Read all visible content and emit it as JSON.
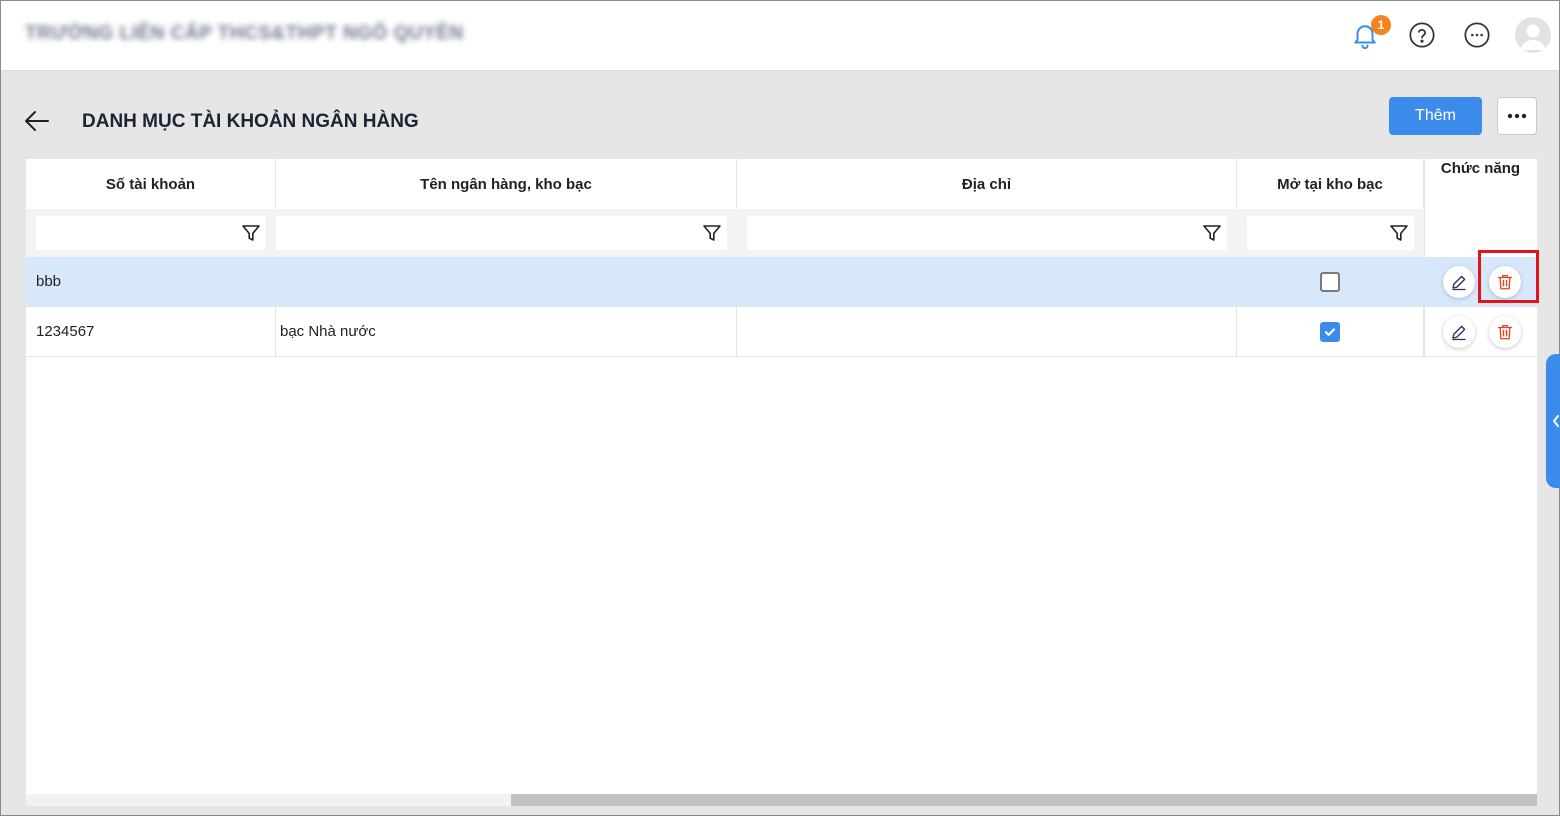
{
  "header": {
    "school_name": "TRƯỜNG LIÊN CẤP THCS&THPT NGÔ QUYỀN",
    "notification_count": "1",
    "icons": [
      "bell-icon",
      "help-icon",
      "more-horizontal-icon",
      "avatar-icon"
    ]
  },
  "page": {
    "title": "DANH MỤC TÀI KHOẢN NGÂN HÀNG",
    "add_label": "Thêm"
  },
  "table": {
    "columns": [
      "Số tài khoản",
      "Tên ngân hàng, kho bạc",
      "Địa chỉ",
      "Mở tại kho bạc",
      "Chức năng"
    ],
    "filters": [
      "",
      "",
      "",
      ""
    ],
    "rows": [
      {
        "account_number": "bbb",
        "bank_name": "",
        "address": "",
        "opened_at_treasury": false,
        "selected": true
      },
      {
        "account_number": "1234567",
        "bank_name": "bạc Nhà nước",
        "address": "",
        "opened_at_treasury": true,
        "selected": false
      }
    ]
  },
  "colors": {
    "accent": "#3b8beb",
    "selected_row": "#d8e8fb",
    "delete_icon": "#e8421c",
    "highlight_box": "#e1141b",
    "badge": "#f5841f"
  }
}
